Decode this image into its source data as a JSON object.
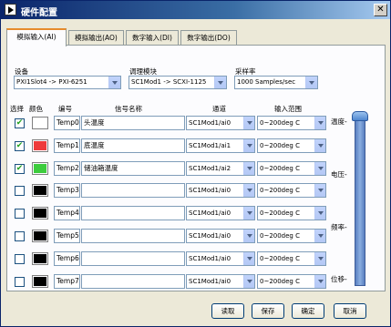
{
  "window": {
    "title": "硬件配置"
  },
  "tabs": [
    {
      "label": "模拟输入(AI)",
      "active": true
    },
    {
      "label": "模拟输出(AO)",
      "active": false
    },
    {
      "label": "数字输入(DI)",
      "active": false
    },
    {
      "label": "数字输出(DO)",
      "active": false
    }
  ],
  "config": {
    "device_label": "设备",
    "device_value": "PXI1Slot4 -> PXI-6251",
    "module_label": "调理模块",
    "module_value": "SC1Mod1 -> SCXI-1125",
    "rate_label": "采样率",
    "rate_value": "1000 Samples/sec"
  },
  "table": {
    "headers": {
      "select": "选择",
      "color": "颜色",
      "number": "编号",
      "signal": "信号名称",
      "channel": "通道",
      "range": "输入范围"
    },
    "rows": [
      {
        "checked": true,
        "color": "#ffffff",
        "id": "Temp0",
        "name": "头温度",
        "channel": "SC1Mod1/ai0",
        "range": "0~200deg C"
      },
      {
        "checked": true,
        "color": "#ee3b3b",
        "id": "Temp1",
        "name": "底温度",
        "channel": "SC1Mod1/ai1",
        "range": "0~200deg C"
      },
      {
        "checked": true,
        "color": "#3dcc3d",
        "id": "Temp2",
        "name": "储油箱温度",
        "channel": "SC1Mod1/ai2",
        "range": "0~200deg C"
      },
      {
        "checked": false,
        "color": "#000000",
        "id": "Temp3",
        "name": "",
        "channel": "SC1Mod1/ai0",
        "range": "0~200deg C"
      },
      {
        "checked": false,
        "color": "#000000",
        "id": "Temp4",
        "name": "",
        "channel": "SC1Mod1/ai0",
        "range": "0~200deg C"
      },
      {
        "checked": false,
        "color": "#000000",
        "id": "Temp5",
        "name": "",
        "channel": "SC1Mod1/ai0",
        "range": "0~200deg C"
      },
      {
        "checked": false,
        "color": "#000000",
        "id": "Temp6",
        "name": "",
        "channel": "SC1Mod1/ai0",
        "range": "0~200deg C"
      },
      {
        "checked": false,
        "color": "#000000",
        "id": "Temp7",
        "name": "",
        "channel": "SC1Mod1/ai0",
        "range": "0~200deg C"
      }
    ]
  },
  "scale": {
    "labels": [
      "温度-",
      "电压-",
      "频率-",
      "位移-"
    ]
  },
  "buttons": {
    "read": "读取",
    "save": "保存",
    "ok": "确定",
    "cancel": "取消"
  }
}
